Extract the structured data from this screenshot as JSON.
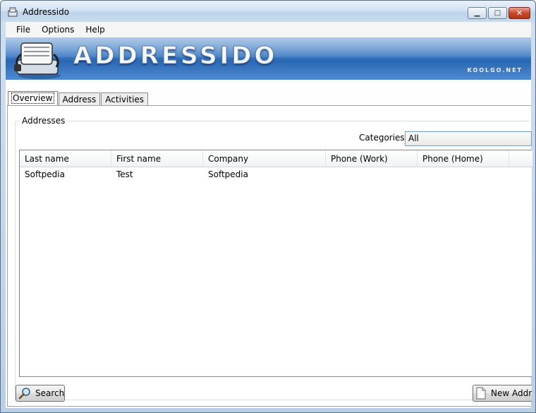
{
  "window": {
    "title": "Addressido",
    "minimize_glyph": "▁",
    "maximize_glyph": "□",
    "close_glyph": "✕"
  },
  "menu": {
    "items": [
      "File",
      "Options",
      "Help"
    ]
  },
  "banner": {
    "title": "ADDRESSIDO",
    "subtitle": "KOOLGO.NET"
  },
  "tabs": [
    {
      "label": "Overview",
      "active": true
    },
    {
      "label": "Address",
      "active": false
    },
    {
      "label": "Activities",
      "active": false
    }
  ],
  "addresses": {
    "group_label": "Addresses",
    "categories_label": "Categories:",
    "categories_value": "All",
    "columns": [
      "Last name",
      "First name",
      "Company",
      "Phone (Work)",
      "Phone (Home)"
    ],
    "rows": [
      [
        "Softpedia",
        "Test",
        "Softpedia",
        "",
        ""
      ]
    ]
  },
  "buttons": {
    "search": "Search",
    "new_address": "New Address"
  },
  "colors": {
    "banner": "#3d7ac3",
    "close_button": "#c84a2a"
  }
}
